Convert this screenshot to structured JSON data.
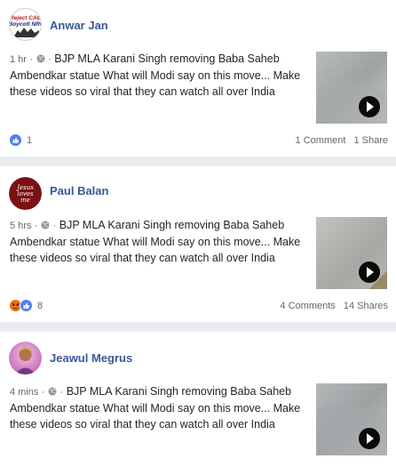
{
  "posts": [
    {
      "author": "Anwar Jan",
      "avatar_text": "Reject CAB, Boycott NRC",
      "time": "1 hr",
      "separator": "·",
      "text": "BJP MLA Karani Singh removing Baba Saheb Ambendkar statue What will Modi say on this move... Make these videos so viral that they can watch all over India",
      "reaction_count": "1",
      "comments": "1 Comment",
      "shares": "1 Share"
    },
    {
      "author": "Paul Balan",
      "avatar_text": "Jesus loves me",
      "time": "5 hrs",
      "separator": "·",
      "text": "BJP MLA Karani Singh removing Baba Saheb Ambendkar statue What will Modi say on this move... Make these videos so viral that they can watch all over India",
      "reaction_count": "8",
      "comments": "4 Comments",
      "shares": "14 Shares"
    },
    {
      "author": "Jeawul Megrus",
      "time": "4 mins",
      "separator": "·",
      "text": "BJP MLA Karani Singh removing Baba Saheb Ambendkar statue What will Modi say on this move... Make these videos so viral that they can watch all over India"
    }
  ],
  "icons": {
    "globe": "globe-icon",
    "play": "play-icon",
    "like": "like-reaction-icon",
    "angry": "angry-reaction-icon"
  },
  "colors": {
    "author": "#385898",
    "like": "#4a80f5",
    "angry": "#e9710f",
    "background": "#e9ebee"
  }
}
